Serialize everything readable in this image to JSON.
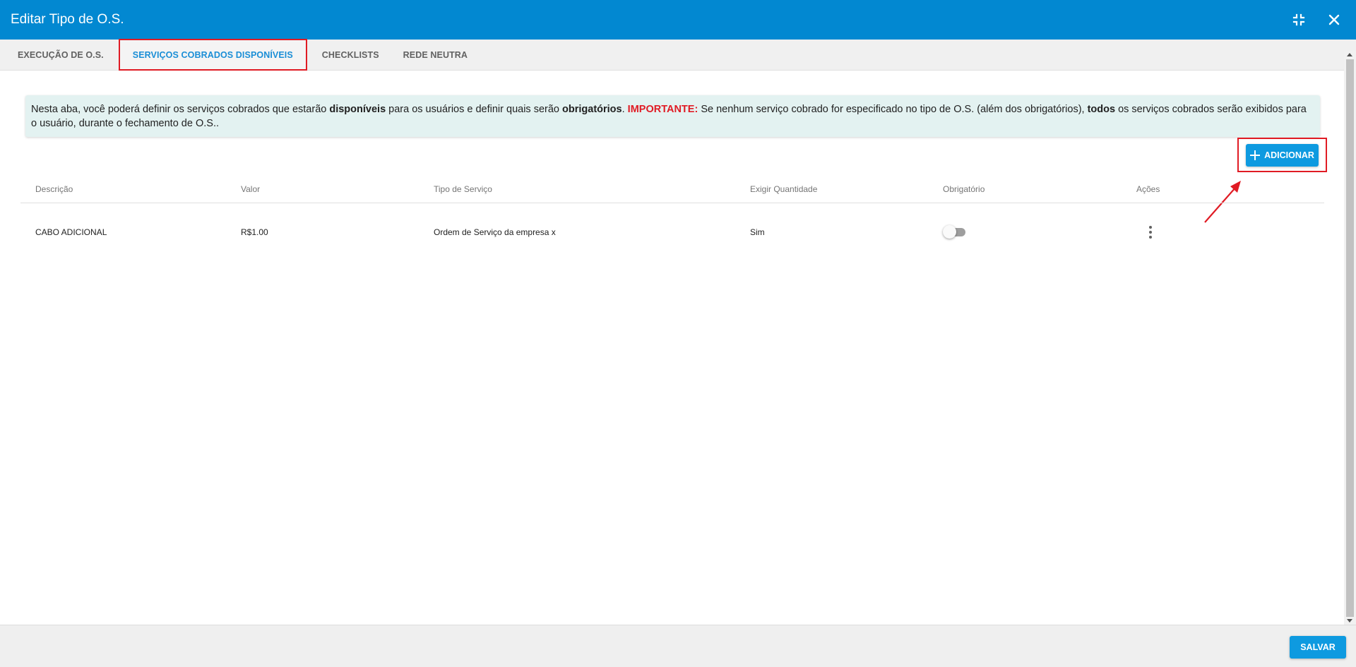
{
  "window": {
    "title": "Editar Tipo de O.S.",
    "accent_color": "#0288d1",
    "actions": [
      {
        "name": "collapse-icon"
      },
      {
        "name": "close-icon"
      }
    ]
  },
  "tabs": [
    {
      "label": "EXECUÇÃO DE O.S.",
      "active": false
    },
    {
      "label": "SERVIÇOS COBRADOS DISPONÍVEIS",
      "active": true
    },
    {
      "label": "CHECKLISTS",
      "active": false
    },
    {
      "label": "REDE NEUTRA",
      "active": false
    }
  ],
  "info": {
    "part1": "Nesta aba, você poderá definir os serviços cobrados que estarão ",
    "bold1": "disponíveis",
    "part2": " para os usuários e definir quais serão ",
    "bold2": "obrigatórios",
    "part3": ". ",
    "important": "IMPORTANTE:",
    "part4": " Se nenhum serviço cobrado for especificado no tipo de O.S. (além dos obrigatórios), ",
    "bold3": "todos",
    "part5": " os serviços cobrados serão exibidos para o usuário, durante o fechamento de O.S..",
    "important_color": "#e01b24"
  },
  "add_button": {
    "label": "ADICIONAR",
    "icon": "plus-icon"
  },
  "table": {
    "headers": [
      "Descrição",
      "Valor",
      "Tipo de Serviço",
      "Exigir Quantidade",
      "Obrigatório",
      "Ações"
    ],
    "rows": [
      {
        "descricao": "CABO ADICIONAL",
        "valor": "R$1.00",
        "tipo": "Ordem de Serviço da empresa x",
        "exigir_quantidade": "Sim",
        "obrigatorio": false
      }
    ]
  },
  "footer": {
    "save_label": "SALVAR"
  },
  "annotation_color": "#e01b24"
}
